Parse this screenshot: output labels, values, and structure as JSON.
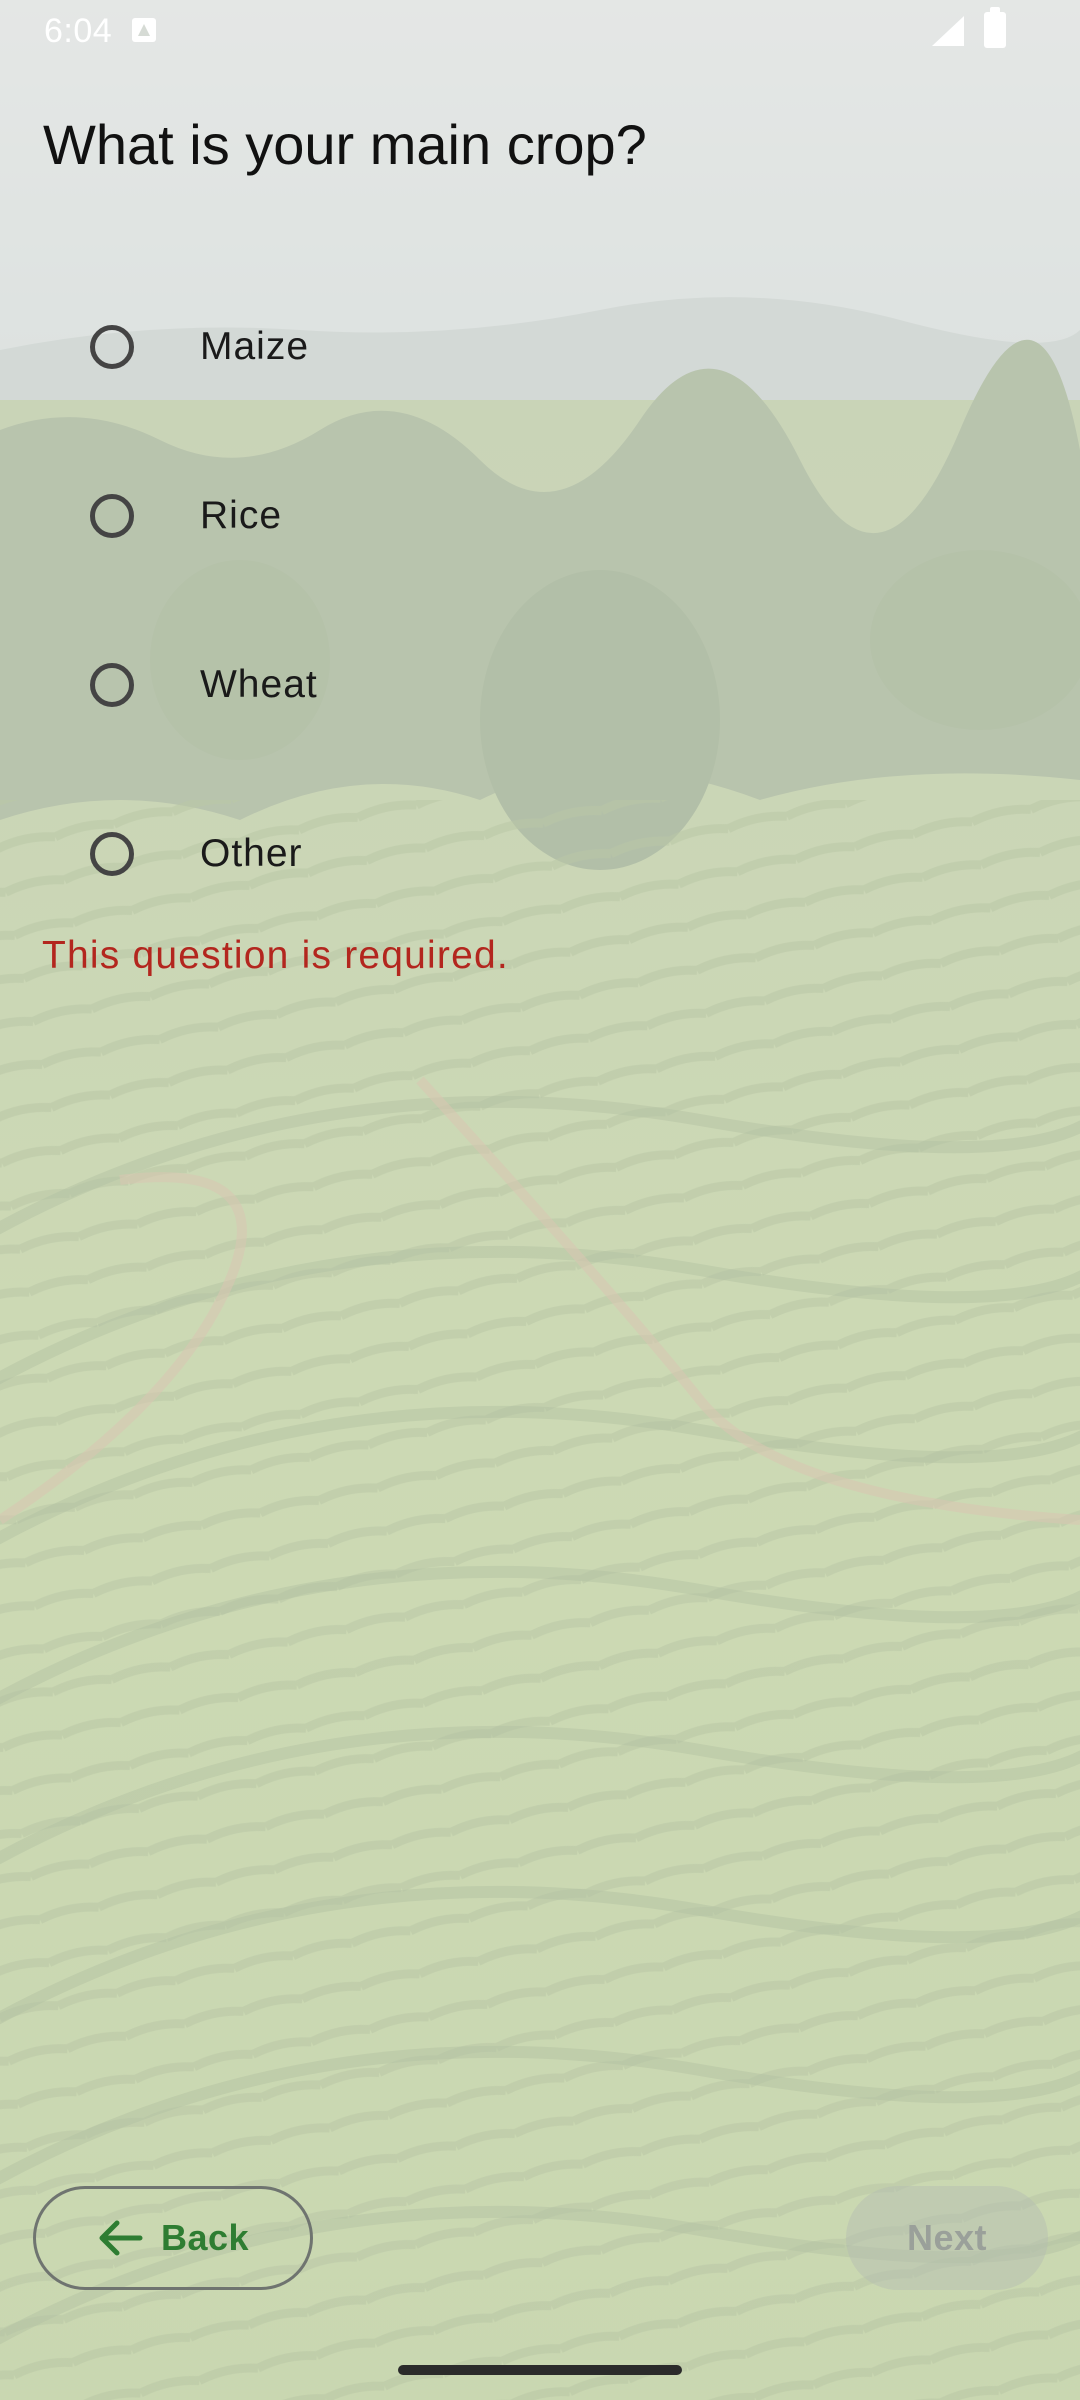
{
  "status_bar": {
    "time": "6:04"
  },
  "question": {
    "title": "What is your main crop?"
  },
  "options": [
    {
      "label": "Maize",
      "selected": false
    },
    {
      "label": "Rice",
      "selected": false
    },
    {
      "label": "Wheat",
      "selected": false
    },
    {
      "label": "Other",
      "selected": false
    }
  ],
  "validation": {
    "error": "This question is required.",
    "color": "#b3261e"
  },
  "navigation": {
    "back_label": "Back",
    "next_label": "Next",
    "next_enabled": false,
    "accent_color": "#2e7d32"
  }
}
